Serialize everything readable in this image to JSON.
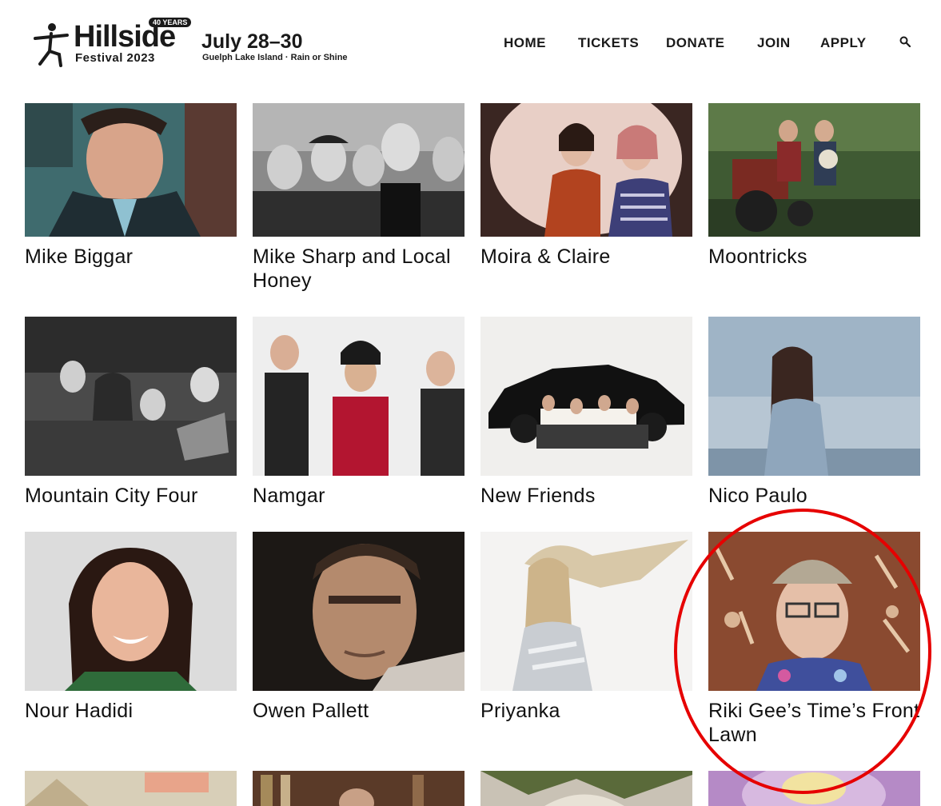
{
  "header": {
    "logo_name": "Hillside",
    "logo_years": "40 YEARS",
    "logo_sub": "Festival 2023",
    "dates": "July 28–30",
    "venue": "Guelph Lake Island · Rain or Shine"
  },
  "nav": {
    "items": [
      {
        "label": "HOME"
      },
      {
        "label": "TICKETS"
      },
      {
        "label": "DONATE"
      },
      {
        "label": "JOIN"
      },
      {
        "label": "APPLY"
      }
    ],
    "search_icon": "search-icon"
  },
  "artists": [
    {
      "name": "Mike Biggar"
    },
    {
      "name": "Mike Sharp and Local Honey"
    },
    {
      "name": "Moira & Claire"
    },
    {
      "name": "Moontricks"
    },
    {
      "name": "Mountain City Four"
    },
    {
      "name": "Namgar"
    },
    {
      "name": "New Friends"
    },
    {
      "name": "Nico Paulo"
    },
    {
      "name": "Nour Hadidi"
    },
    {
      "name": "Owen Pallett"
    },
    {
      "name": "Priyanka"
    },
    {
      "name": "Riki Gee’s Time’s Front Lawn"
    }
  ],
  "colors": {
    "highlight": "#e60000",
    "text": "#111111"
  }
}
